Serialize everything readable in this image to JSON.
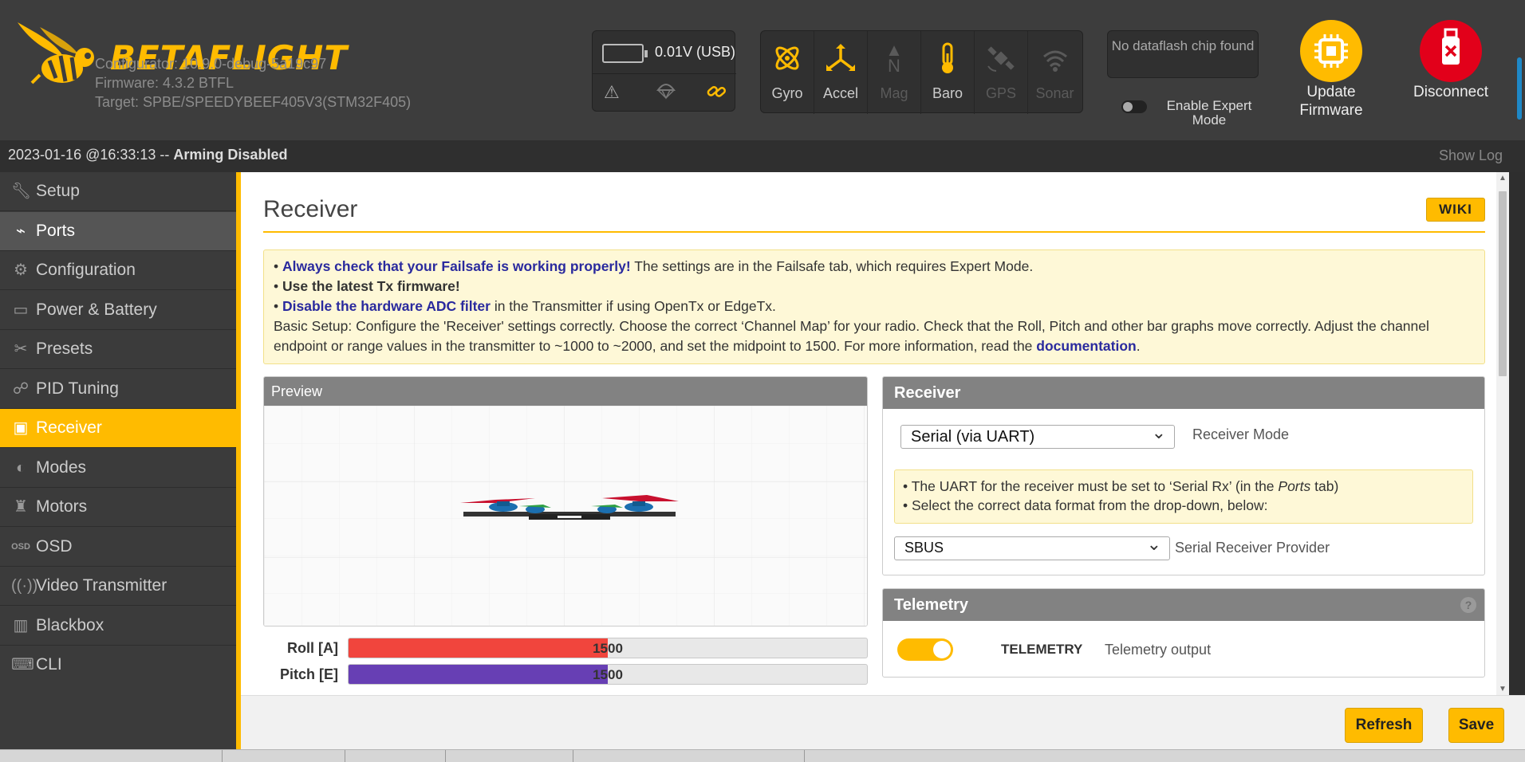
{
  "header": {
    "brand_prefix": "BETA",
    "brand_suffix": "FLIGHT",
    "configurator": "Configurator: 10.9.0-debug-5a19c97",
    "firmware": "Firmware: 4.3.2 BTFL",
    "target": "Target: SPBE/SPEEDYBEEF405V3(STM32F405)",
    "battery": "0.01V (USB)",
    "sensors": [
      {
        "label": "Gyro",
        "icon": "gyro-icon",
        "active": true
      },
      {
        "label": "Accel",
        "icon": "accel-icon",
        "active": true
      },
      {
        "label": "Mag",
        "icon": "mag-icon",
        "active": false
      },
      {
        "label": "Baro",
        "icon": "baro-icon",
        "active": true
      },
      {
        "label": "GPS",
        "icon": "gps-icon",
        "active": false
      },
      {
        "label": "Sonar",
        "icon": "sonar-icon",
        "active": false
      }
    ],
    "dataflash": "No dataflash chip found",
    "expert_mode": "Enable Expert Mode",
    "update_firmware": "Update Firmware",
    "disconnect": "Disconnect"
  },
  "status": {
    "timestamp": "2023-01-16 @16:33:13 --",
    "state": "Arming Disabled",
    "show_log": "Show Log"
  },
  "sidebar": {
    "items": [
      {
        "label": "Setup",
        "icon": "wrench-icon"
      },
      {
        "label": "Ports",
        "icon": "plug-icon"
      },
      {
        "label": "Configuration",
        "icon": "gear-icon"
      },
      {
        "label": "Power & Battery",
        "icon": "battery-icon"
      },
      {
        "label": "Presets",
        "icon": "presets-icon"
      },
      {
        "label": "PID Tuning",
        "icon": "pid-icon"
      },
      {
        "label": "Receiver",
        "icon": "receiver-icon"
      },
      {
        "label": "Modes",
        "icon": "modes-icon"
      },
      {
        "label": "Motors",
        "icon": "motor-icon"
      },
      {
        "label": "OSD",
        "icon": "osd-icon"
      },
      {
        "label": "Video Transmitter",
        "icon": "vtx-icon"
      },
      {
        "label": "Blackbox",
        "icon": "blackbox-icon"
      },
      {
        "label": "CLI",
        "icon": "cli-icon"
      }
    ],
    "active": "Receiver"
  },
  "main": {
    "title": "Receiver",
    "wiki": "WIKI",
    "note": {
      "line1_em": "Always check that your Failsafe is working properly!",
      "line1_rest": " The settings are in the Failsafe tab, which requires Expert Mode.",
      "line2": "Use the latest Tx firmware!",
      "line3_em": "Disable the hardware ADC filter",
      "line3_rest": " in the Transmitter if using OpenTx or EdgeTx.",
      "line4": "Basic Setup: Configure the 'Receiver' settings correctly. Choose the correct ‘Channel Map’ for your radio. Check that the Roll, Pitch and other bar graphs move correctly. Adjust the channel endpoint or range values in the transmitter to ~1000 to ~2000, and set the midpoint to 1500. For more information, read the ",
      "doc_link": "documentation",
      "line4_end": "."
    },
    "preview_title": "Preview",
    "bars": [
      {
        "name": "Roll [A]",
        "value": "1500",
        "fraction": 0.5,
        "color": "#f1453d"
      },
      {
        "name": "Pitch [E]",
        "value": "1500",
        "fraction": 0.5,
        "color": "#673fb4"
      }
    ],
    "receiver": {
      "title": "Receiver",
      "mode_value": "Serial (via UART)",
      "mode_label": "Receiver Mode",
      "note1_a": "The UART for the receiver must be set to ‘Serial Rx’ (in the ",
      "note1_em": "Ports",
      "note1_b": " tab)",
      "note2": "Select the correct data format from the drop-down, below:",
      "provider_value": "SBUS",
      "provider_label": "Serial Receiver Provider"
    },
    "telemetry": {
      "title": "Telemetry",
      "help": "?",
      "name": "TELEMETRY",
      "desc": "Telemetry output",
      "enabled": true
    }
  },
  "toolbar": {
    "refresh": "Refresh",
    "save": "Save"
  },
  "colors": {
    "accent": "#ffbb00",
    "header": "#3d3d3d",
    "disconnect": "#e2001a"
  }
}
